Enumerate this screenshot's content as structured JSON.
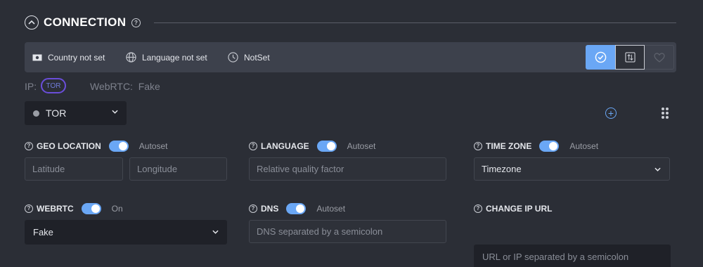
{
  "header": {
    "title": "CONNECTION",
    "help_icon": "help-circle-icon",
    "collapse_icon": "chevron-up-icon"
  },
  "summary_bar": {
    "country": "Country not set",
    "language": "Language not set",
    "timezone": "NotSet",
    "actions": [
      "check-icon",
      "swap-icon",
      "heart-icon"
    ]
  },
  "ip_info": {
    "ip_label": "IP:",
    "ip_badge": "TOR",
    "webrtc": "WebRTC:  Fake"
  },
  "proxy": {
    "selected": "TOR"
  },
  "geolocation": {
    "label": "GEO LOCATION",
    "autoset": "Autoset",
    "latitude_placeholder": "Latitude",
    "longitude_placeholder": "Longitude"
  },
  "language": {
    "label": "LANGUAGE",
    "autoset": "Autoset",
    "placeholder": "Relative quality factor"
  },
  "timezone": {
    "label": "TIME ZONE",
    "autoset": "Autoset",
    "value": "Timezone"
  },
  "webrtc": {
    "label": "WEBRTC",
    "state": "On",
    "value": "Fake"
  },
  "dns": {
    "label": "DNS",
    "autoset": "Autoset",
    "placeholder": "DNS separated by a semicolon"
  },
  "change_ip": {
    "label": "CHANGE IP URL",
    "placeholder": "URL or IP separated by a semicolon"
  },
  "colors": {
    "accent": "#6aa7f5",
    "tor_badge": "#6a4ed9",
    "background": "#2b2e36"
  }
}
